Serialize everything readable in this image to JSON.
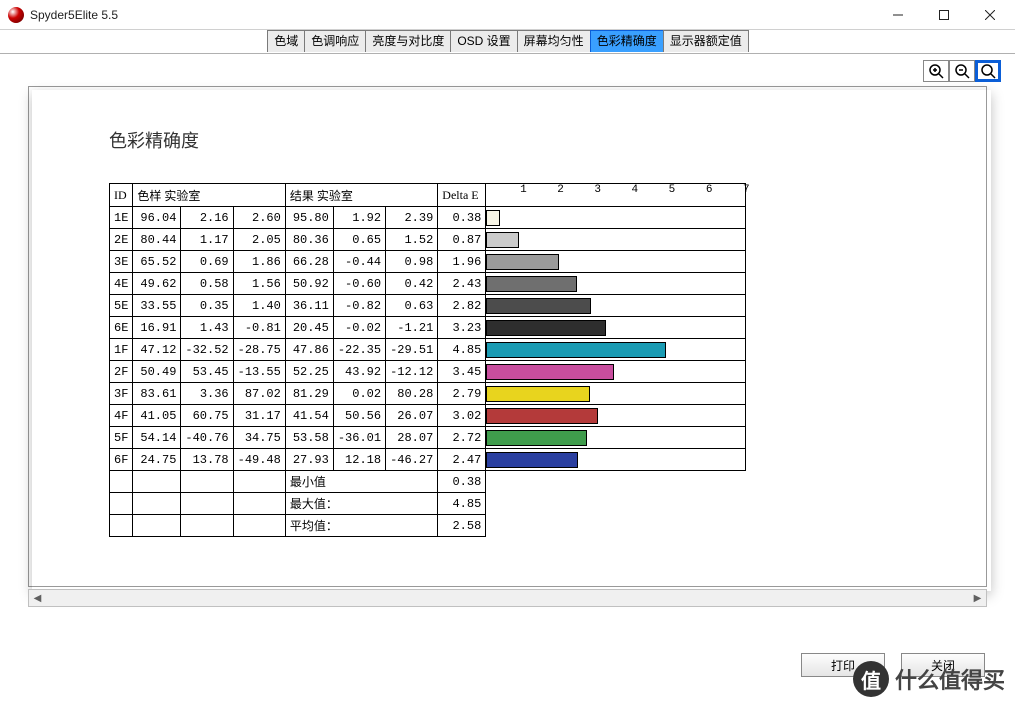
{
  "window": {
    "title": "Spyder5Elite 5.5"
  },
  "tabs": [
    {
      "label": "色域",
      "selected": false
    },
    {
      "label": "色调响应",
      "selected": false
    },
    {
      "label": "亮度与对比度",
      "selected": false
    },
    {
      "label": "OSD 设置",
      "selected": false
    },
    {
      "label": "屏幕均匀性",
      "selected": false
    },
    {
      "label": "色彩精确度",
      "selected": true
    },
    {
      "label": "显示器额定值",
      "selected": false
    }
  ],
  "section": {
    "title": "色彩精确度"
  },
  "table": {
    "headers": {
      "id": "ID",
      "sample": "色样 实验室",
      "result": "结果 实验室",
      "delta": "Delta E"
    },
    "axis_ticks": [
      "1",
      "2",
      "3",
      "4",
      "5",
      "6",
      "7"
    ],
    "rows": [
      {
        "id": "1E",
        "s1": "96.04",
        "s2": "2.16",
        "s3": "2.60",
        "r1": "95.80",
        "r2": "1.92",
        "r3": "2.39",
        "delta": "0.38",
        "color": "#f7f5e6"
      },
      {
        "id": "2E",
        "s1": "80.44",
        "s2": "1.17",
        "s3": "2.05",
        "r1": "80.36",
        "r2": "0.65",
        "r3": "1.52",
        "delta": "0.87",
        "color": "#cbcbcb"
      },
      {
        "id": "3E",
        "s1": "65.52",
        "s2": "0.69",
        "s3": "1.86",
        "r1": "66.28",
        "r2": "-0.44",
        "r3": "0.98",
        "delta": "1.96",
        "color": "#9b9b9b"
      },
      {
        "id": "4E",
        "s1": "49.62",
        "s2": "0.58",
        "s3": "1.56",
        "r1": "50.92",
        "r2": "-0.60",
        "r3": "0.42",
        "delta": "2.43",
        "color": "#6f6f6f"
      },
      {
        "id": "5E",
        "s1": "33.55",
        "s2": "0.35",
        "s3": "1.40",
        "r1": "36.11",
        "r2": "-0.82",
        "r3": "0.63",
        "delta": "2.82",
        "color": "#4c4c4c"
      },
      {
        "id": "6E",
        "s1": "16.91",
        "s2": "1.43",
        "s3": "-0.81",
        "r1": "20.45",
        "r2": "-0.02",
        "r3": "-1.21",
        "delta": "3.23",
        "color": "#2e2e2e"
      },
      {
        "id": "1F",
        "s1": "47.12",
        "s2": "-32.52",
        "s3": "-28.75",
        "r1": "47.86",
        "r2": "-22.35",
        "r3": "-29.51",
        "delta": "4.85",
        "color": "#1a9bb3"
      },
      {
        "id": "2F",
        "s1": "50.49",
        "s2": "53.45",
        "s3": "-13.55",
        "r1": "52.25",
        "r2": "43.92",
        "r3": "-12.12",
        "delta": "3.45",
        "color": "#c84d9e"
      },
      {
        "id": "3F",
        "s1": "83.61",
        "s2": "3.36",
        "s3": "87.02",
        "r1": "81.29",
        "r2": "0.02",
        "r3": "80.28",
        "delta": "2.79",
        "color": "#e8d41e"
      },
      {
        "id": "4F",
        "s1": "41.05",
        "s2": "60.75",
        "s3": "31.17",
        "r1": "41.54",
        "r2": "50.56",
        "r3": "26.07",
        "delta": "3.02",
        "color": "#b43a3a"
      },
      {
        "id": "5F",
        "s1": "54.14",
        "s2": "-40.76",
        "s3": "34.75",
        "r1": "53.58",
        "r2": "-36.01",
        "r3": "28.07",
        "delta": "2.72",
        "color": "#3f9c4c"
      },
      {
        "id": "6F",
        "s1": "24.75",
        "s2": "13.78",
        "s3": "-49.48",
        "r1": "27.93",
        "r2": "12.18",
        "r3": "-46.27",
        "delta": "2.47",
        "color": "#2a3fa0"
      }
    ],
    "summary": [
      {
        "label": "最小值",
        "value": "0.38"
      },
      {
        "label": "最大值：",
        "value": "4.85"
      },
      {
        "label": "平均值：",
        "value": "2.58"
      }
    ]
  },
  "chart_data": {
    "type": "bar",
    "title": "色彩精确度",
    "xlabel": "Delta E",
    "ylabel": "",
    "xlim": [
      0,
      7
    ],
    "categories": [
      "1E",
      "2E",
      "3E",
      "4E",
      "5E",
      "6E",
      "1F",
      "2F",
      "3F",
      "4F",
      "5F",
      "6F"
    ],
    "values": [
      0.38,
      0.87,
      1.96,
      2.43,
      2.82,
      3.23,
      4.85,
      3.45,
      2.79,
      3.02,
      2.72,
      2.47
    ],
    "colors": [
      "#f7f5e6",
      "#cbcbcb",
      "#9b9b9b",
      "#6f6f6f",
      "#4c4c4c",
      "#2e2e2e",
      "#1a9bb3",
      "#c84d9e",
      "#e8d41e",
      "#b43a3a",
      "#3f9c4c",
      "#2a3fa0"
    ]
  },
  "buttons": {
    "print": "打印",
    "close": "关闭"
  },
  "watermark": {
    "logo": "值",
    "text": "什么值得买"
  }
}
